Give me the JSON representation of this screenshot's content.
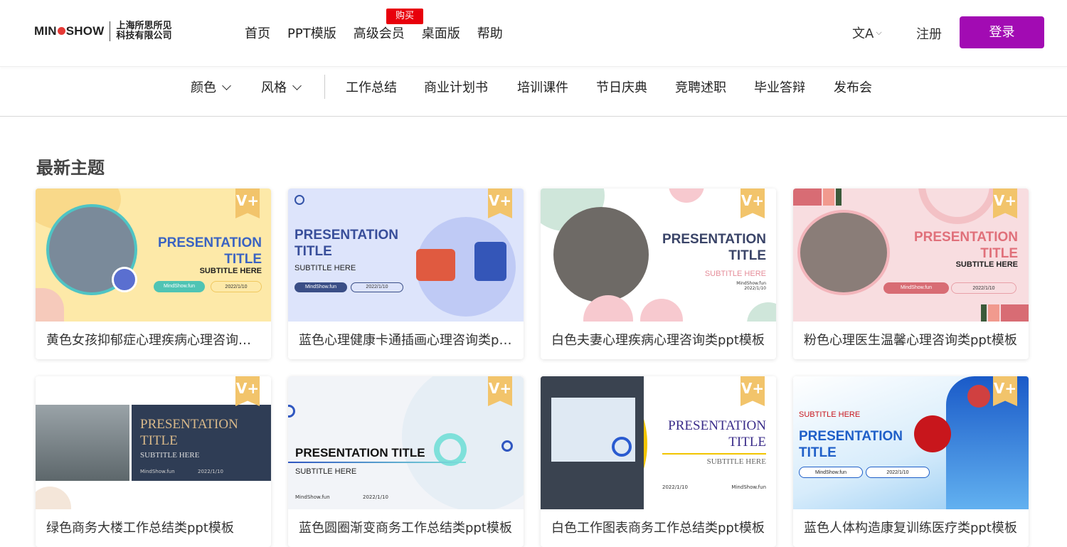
{
  "logo": {
    "brand": "MIND SHOW",
    "company_line1": "上海所思所见",
    "company_line2": "科技有限公司"
  },
  "nav": [
    "首页",
    "PPT模版",
    "高级会员",
    "桌面版",
    "帮助"
  ],
  "buy_badge": "购买",
  "lang_icon": "文A",
  "register": "注册",
  "login": "登录",
  "filters": [
    "颜色",
    "风格"
  ],
  "categories": [
    "工作总结",
    "商业计划书",
    "培训课件",
    "节日庆典",
    "竞聘述职",
    "毕业答辩",
    "发布会"
  ],
  "section_title": "最新主题",
  "cards": [
    {
      "name": "黄色女孩抑郁症心理疾病心理咨询类ppt模板",
      "title1": "PRESENTATION",
      "title2": "TITLE",
      "subtitle": "SUBTITLE HERE",
      "site": "MindShow.fun",
      "date": "2022/1/10"
    },
    {
      "name": "蓝色心理健康卡通插画心理咨询类ppt模板",
      "title1": "PRESENTATION",
      "title2": "TITLE",
      "subtitle": "SUBTITLE HERE",
      "site": "MindShow.fun",
      "date": "2022/1/10"
    },
    {
      "name": "白色夫妻心理疾病心理咨询类ppt模板",
      "title1": "PRESENTATION",
      "title2": "TITLE",
      "subtitle": "SUBTITLE HERE",
      "site": "MindShow.fun",
      "date": "2022/1/10"
    },
    {
      "name": "粉色心理医生温馨心理咨询类ppt模板",
      "title1": "PRESENTATION",
      "title2": "TITLE",
      "subtitle": "SUBTITLE HERE",
      "site": "MindShow.fun",
      "date": "2022/1/10"
    },
    {
      "name": "绿色商务大楼工作总结类ppt模板",
      "title1": "PRESENTATION",
      "title2": "TITLE",
      "subtitle": "SUBTITLE HERE",
      "site": "MindShow.fun",
      "date": "2022/1/10"
    },
    {
      "name": "蓝色圆圈渐变商务工作总结类ppt模板",
      "title1": "PRESENTATION TITLE",
      "title2": "",
      "subtitle": "SUBTITLE HERE",
      "site": "MindShow.fun",
      "date": "2022/1/10"
    },
    {
      "name": "白色工作图表商务工作总结类ppt模板",
      "title1": "PRESENTATION",
      "title2": "TITLE",
      "subtitle": "SUBTITLE HERE",
      "site": "MindShow.fun",
      "date": "2022/1/10"
    },
    {
      "name": "蓝色人体构造康复训练医疗类ppt模板",
      "title1": "PRESENTATION",
      "title2": "TITLE",
      "subtitle": "SUBTITLE HERE",
      "site": "MindShow.fun",
      "date": "2022/1/10"
    }
  ],
  "badge_text": "V+",
  "accent_color": "#a20bb3",
  "buy_badge_color": "#e8000b"
}
